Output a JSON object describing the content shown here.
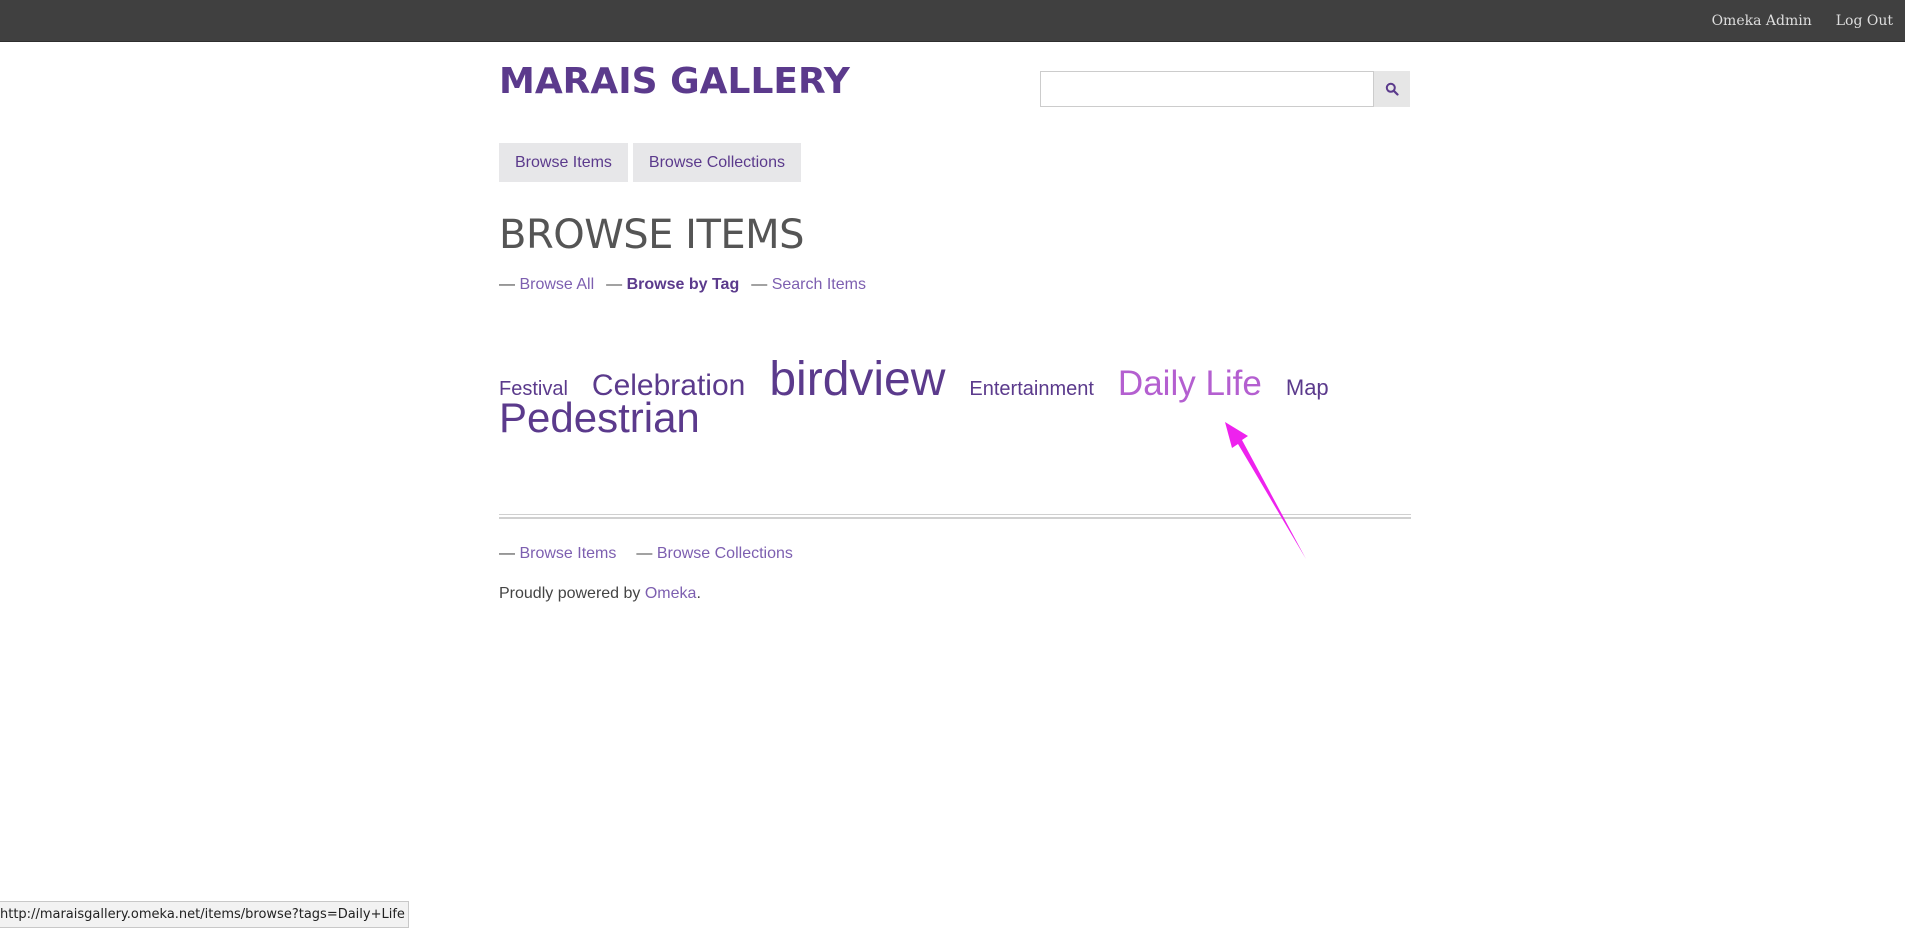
{
  "admin_bar": {
    "links": [
      "Omeka Admin",
      "Log Out"
    ]
  },
  "header": {
    "site_title": "MARAIS GALLERY",
    "search_value": "",
    "search_icon": "search-icon"
  },
  "top_nav": {
    "items": [
      "Browse Items",
      "Browse Collections"
    ]
  },
  "main": {
    "heading": "BROWSE ITEMS",
    "sub_nav": {
      "dash": "—",
      "items": [
        "Browse All",
        "Browse by Tag",
        "Search Items"
      ],
      "active": "Browse by Tag"
    },
    "tags": [
      {
        "label": "Festival"
      },
      {
        "label": "Celebration"
      },
      {
        "label": "birdview"
      },
      {
        "label": "Entertainment"
      },
      {
        "label": "Daily Life",
        "state": "hover"
      },
      {
        "label": "Map"
      },
      {
        "label": "Pedestrian"
      }
    ]
  },
  "footer": {
    "nav": [
      "Browse Items",
      "Browse Collections"
    ],
    "powered_prefix": "Proudly powered by ",
    "powered_link": "Omeka",
    "powered_suffix": "."
  },
  "annotation": {
    "color": "#ee22ee"
  },
  "status_bar": {
    "url": "http://maraisgallery.omeka.net/items/browse?tags=Daily+Life"
  },
  "colors": {
    "accent": "#5b3a8c",
    "link": "#7d5fb0",
    "hover_tag": "#b45fd0",
    "admin_bar": "#404040"
  }
}
